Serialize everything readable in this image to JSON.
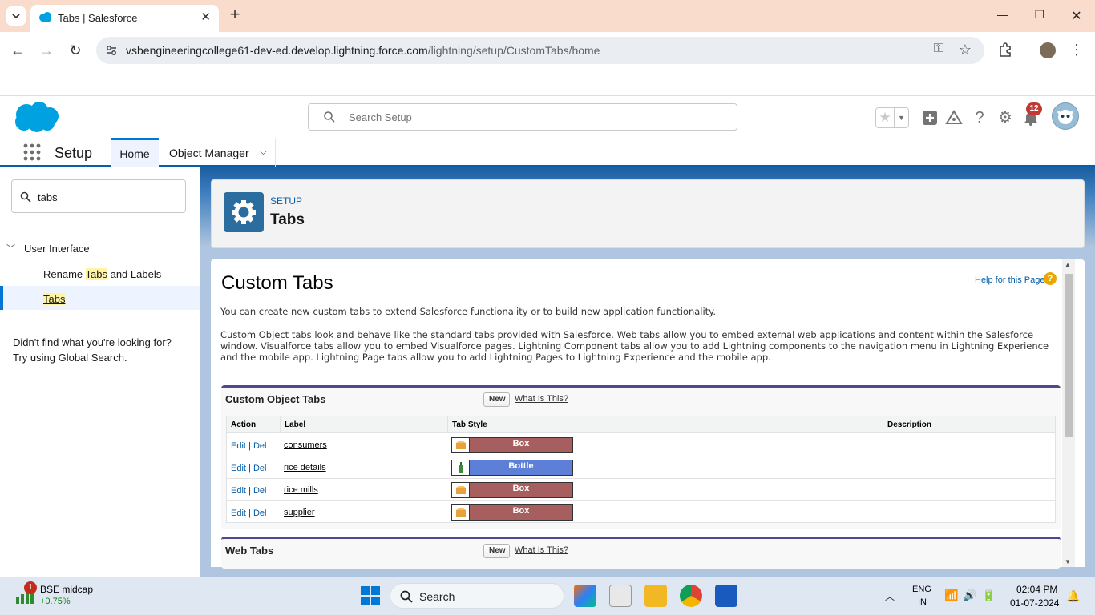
{
  "browser": {
    "tab_title": "Tabs | Salesforce",
    "url_host": "vsbengineeringcollege61-dev-ed.develop.lightning.force.com",
    "url_path": "/lightning/setup/CustomTabs/home"
  },
  "header": {
    "search_placeholder": "Search Setup",
    "notification_count": "12"
  },
  "nav": {
    "app_name": "Setup",
    "home_label": "Home",
    "object_manager_label": "Object Manager"
  },
  "sidebar": {
    "quick_find_value": "tabs",
    "group_label": "User Interface",
    "rename_pre": "Rename ",
    "rename_hl": "Tabs",
    "rename_post": " and Labels",
    "tabs_label": "Tabs",
    "no_result_line1": "Didn't find what you're looking for?",
    "no_result_line2": "Try using Global Search."
  },
  "page_header": {
    "crumb": "SETUP",
    "title": "Tabs"
  },
  "content": {
    "title": "Custom Tabs",
    "help_link": "Help for this Page",
    "intro1": "You can create new custom tabs to extend Salesforce functionality or to build new application functionality.",
    "intro2": "Custom Object tabs look and behave like the standard tabs provided with Salesforce. Web tabs allow you to embed external web applications and content within the Salesforce window. Visualforce tabs allow you to embed Visualforce pages. Lightning Component tabs allow you to add Lightning components to the navigation menu in Lightning Experience and the mobile app. Lightning Page tabs allow you to add Lightning Pages to Lightning Experience and the mobile app.",
    "custom_object_tabs": {
      "heading": "Custom Object Tabs",
      "new_label": "New",
      "what_is_this": "What Is This?",
      "columns": [
        "Action",
        "Label",
        "Tab Style",
        "Description"
      ],
      "edit_label": "Edit",
      "sep": "|",
      "del_label": "Del",
      "rows": [
        {
          "label": "consumers",
          "style": "Box",
          "color": "#a65e5e"
        },
        {
          "label": "rice details",
          "style": "Bottle",
          "color": "#5d7fd8"
        },
        {
          "label": "rice mills",
          "style": "Box",
          "color": "#a65e5e"
        },
        {
          "label": "supplier",
          "style": "Box",
          "color": "#a65e5e"
        }
      ]
    },
    "web_tabs": {
      "heading": "Web Tabs",
      "new_label": "New",
      "what_is_this": "What Is This?"
    }
  },
  "taskbar": {
    "stock_name": "BSE midcap",
    "stock_change": "+0.75%",
    "stock_badge": "1",
    "search_label": "Search",
    "lang1": "ENG",
    "lang2": "IN",
    "time": "02:04 PM",
    "date": "01-07-2024"
  }
}
